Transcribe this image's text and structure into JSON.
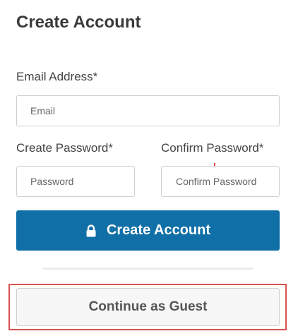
{
  "form": {
    "title": "Create Account",
    "email": {
      "label": "Email Address*",
      "placeholder": "Email",
      "value": ""
    },
    "password": {
      "label": "Create Password*",
      "placeholder": "Password",
      "value": ""
    },
    "confirm_password": {
      "label": "Confirm Password*",
      "placeholder": "Confirm Password",
      "value": ""
    },
    "submit_label": "Create Account",
    "guest_label": "Continue as Guest"
  },
  "colors": {
    "primary_button": "#0f6fa6",
    "highlight_border": "#d9534f",
    "guest_button_bg": "#f7f7f7"
  },
  "icons": {
    "submit": "lock-icon"
  }
}
